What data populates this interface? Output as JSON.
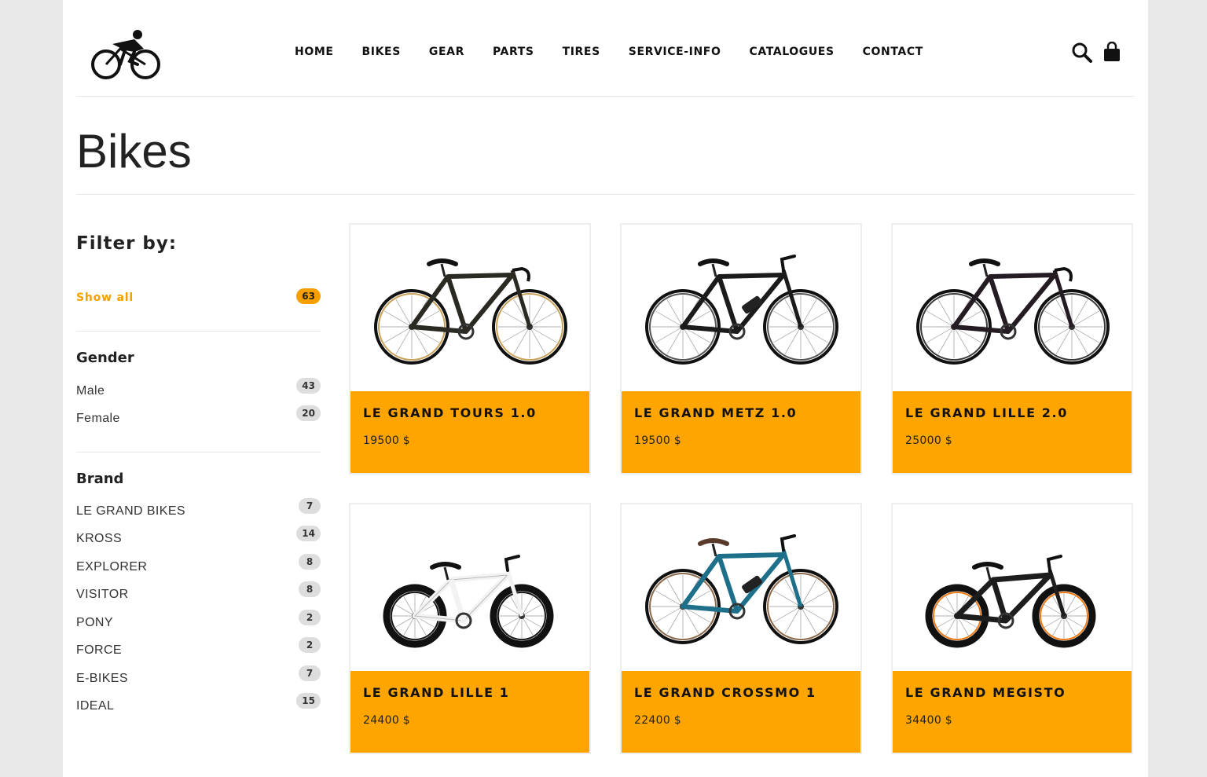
{
  "nav": [
    "HOME",
    "BIKES",
    "GEAR",
    "PARTS",
    "TIRES",
    "SERVICE-INFO",
    "CATALOGUES",
    "CONTACT"
  ],
  "page_title": "Bikes",
  "filter": {
    "title": "Filter by:",
    "show_all": {
      "label": "Show all",
      "count": "63"
    },
    "gender": {
      "title": "Gender",
      "items": [
        {
          "label": "Male",
          "count": "43"
        },
        {
          "label": "Female",
          "count": "20"
        }
      ]
    },
    "brand": {
      "title": "Brand",
      "items": [
        {
          "label": "LE GRAND BIKES",
          "count": "7"
        },
        {
          "label": "KROSS",
          "count": "14"
        },
        {
          "label": "EXPLORER",
          "count": "8"
        },
        {
          "label": "VISITOR",
          "count": "8"
        },
        {
          "label": "PONY",
          "count": "2"
        },
        {
          "label": "FORCE",
          "count": "2"
        },
        {
          "label": "E-BIKES",
          "count": "7"
        },
        {
          "label": "IDEAL",
          "count": "15"
        }
      ]
    }
  },
  "products": [
    {
      "name": "LE GRAND TOURS 1.0",
      "price": "19500 $",
      "frame": "#2a2a22",
      "accent": "#c9a15a",
      "kind": "road"
    },
    {
      "name": "LE GRAND METZ 1.0",
      "price": "19500 $",
      "frame": "#1b1b1b",
      "accent": "#555555",
      "kind": "mtb"
    },
    {
      "name": "LE GRAND LILLE 2.0",
      "price": "25000 $",
      "frame": "#241c22",
      "accent": "#3a3a3a",
      "kind": "road"
    },
    {
      "name": "LE GRAND LILLE 1",
      "price": "24400 $",
      "frame": "#f2f2f2",
      "accent": "#111111",
      "kind": "balance"
    },
    {
      "name": "LE GRAND CROSSMO 1",
      "price": "22400 $",
      "frame": "#1e6f8a",
      "accent": "#8a6a4a",
      "kind": "city"
    },
    {
      "name": "LE GRAND MEGISTO",
      "price": "34400 $",
      "frame": "#1d1d1d",
      "accent": "#f07a12",
      "kind": "kids"
    }
  ],
  "icons": {
    "logo": "cyclist-logo",
    "search": "search-icon",
    "cart": "shopping-bag-icon"
  },
  "colors": {
    "accent": "#ffa500",
    "badge": "#dddddd"
  }
}
